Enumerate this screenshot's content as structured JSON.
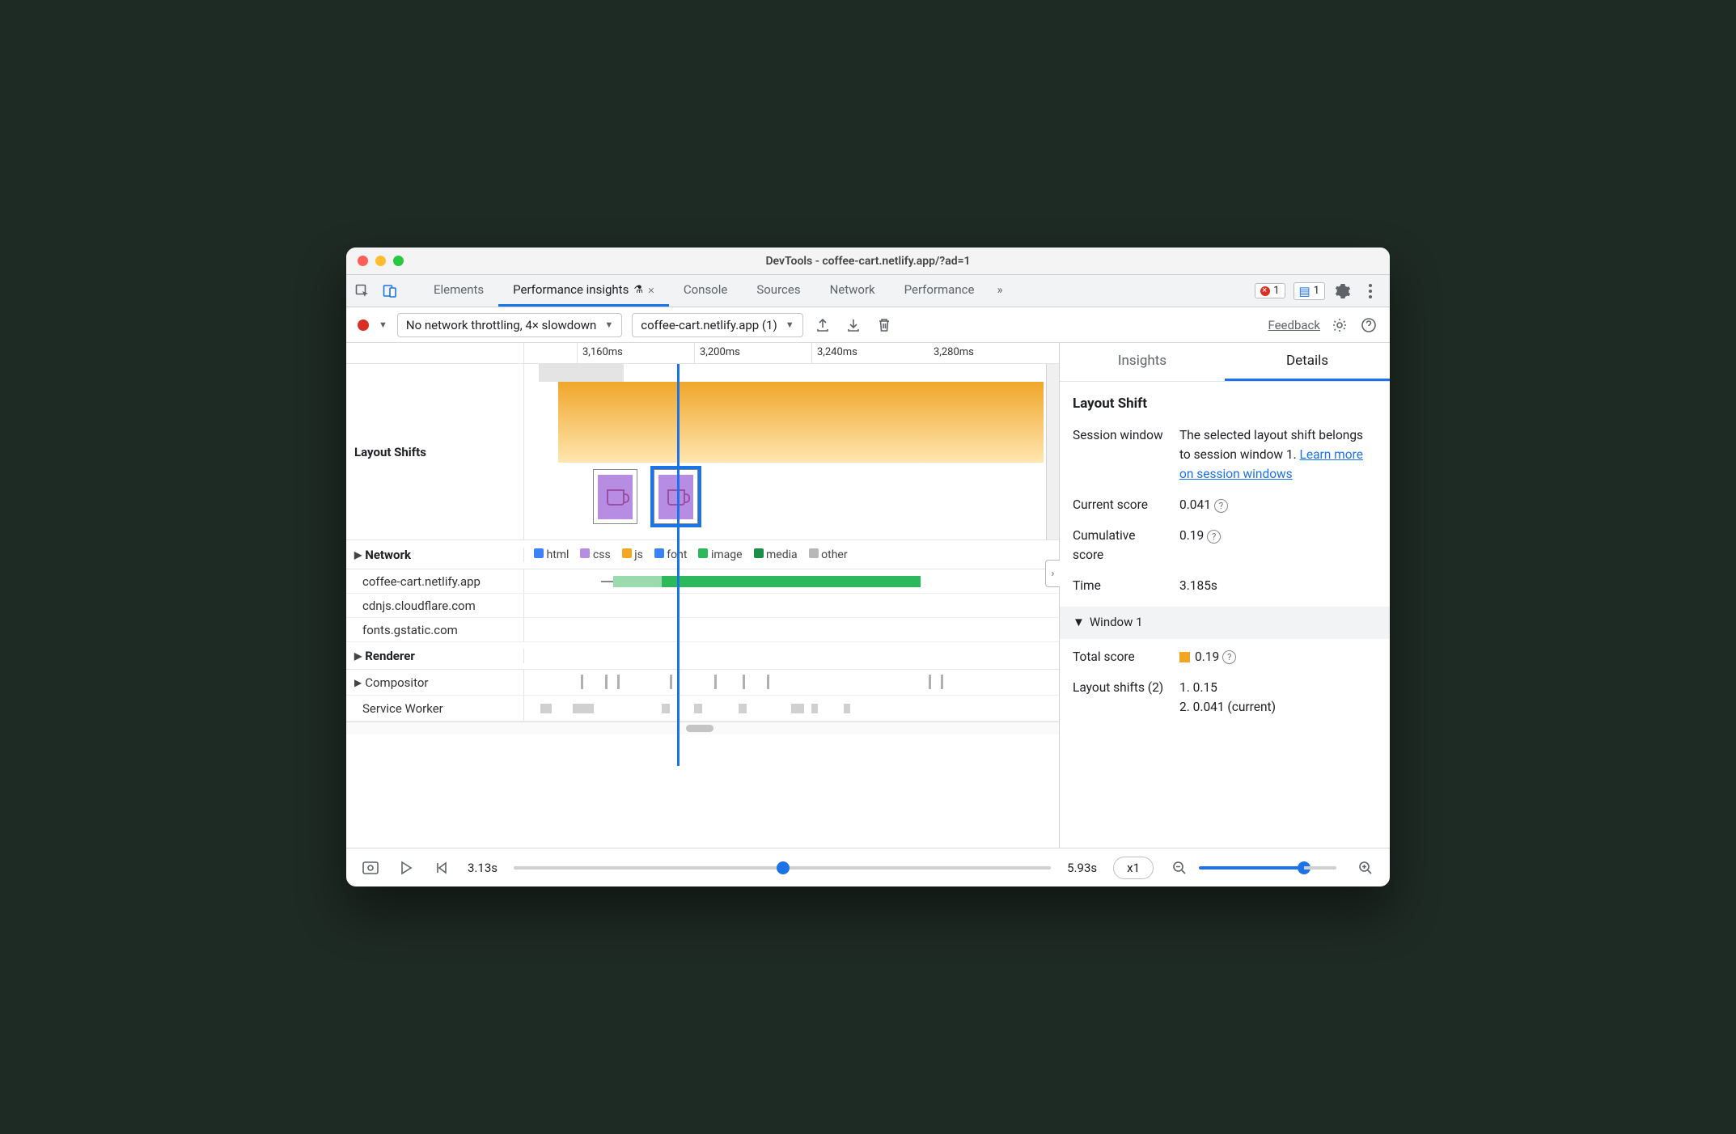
{
  "window": {
    "title": "DevTools - coffee-cart.netlify.app/?ad=1"
  },
  "tabs": {
    "items": [
      "Elements",
      "Performance insights",
      "Console",
      "Sources",
      "Network",
      "Performance"
    ],
    "active_index": 1,
    "error_count": "1",
    "message_count": "1"
  },
  "toolbar": {
    "throttling": "No network throttling, 4× slowdown",
    "target": "coffee-cart.netlify.app (1)",
    "feedback": "Feedback"
  },
  "ruler": {
    "ticks": [
      "3,160ms",
      "3,200ms",
      "3,240ms",
      "3,280ms"
    ]
  },
  "tracks": {
    "layout_shifts_label": "Layout Shifts",
    "network_label": "Network",
    "renderer_label": "Renderer",
    "compositor_label": "Compositor",
    "service_worker_label": "Service Worker",
    "legend": {
      "html": "html",
      "css": "css",
      "js": "js",
      "font": "font",
      "image": "image",
      "media": "media",
      "other": "other"
    },
    "network_hosts": [
      "coffee-cart.netlify.app",
      "cdnjs.cloudflare.com",
      "fonts.gstatic.com"
    ]
  },
  "details": {
    "tabs": {
      "insights": "Insights",
      "details": "Details"
    },
    "heading": "Layout Shift",
    "session_window_label": "Session window",
    "session_window_value_prefix": "The selected layout shift belongs to session window 1. ",
    "session_window_link": "Learn more on session windows",
    "current_score_label": "Current score",
    "current_score_value": "0.041",
    "cumulative_score_label": "Cumulative score",
    "cumulative_score_value": "0.19",
    "time_label": "Time",
    "time_value": "3.185s",
    "window_header": "Window 1",
    "total_score_label": "Total score",
    "total_score_value": "0.19",
    "layout_shifts_label": "Layout shifts (2)",
    "layout_shifts_items": [
      "1. 0.15",
      "2. 0.041 (current)"
    ]
  },
  "footer": {
    "time_start": "3.13s",
    "time_end": "5.93s",
    "speed": "x1"
  }
}
